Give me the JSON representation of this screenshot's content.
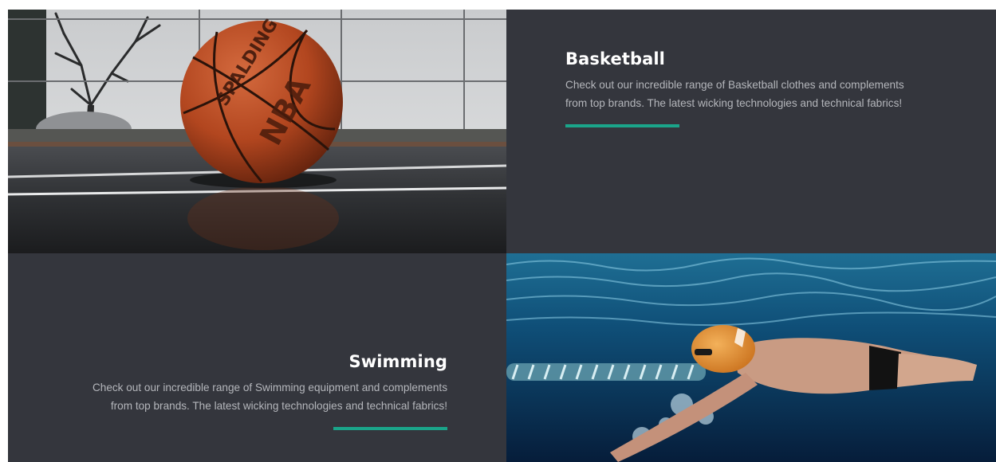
{
  "sections": [
    {
      "title": "Basketball",
      "description_line1": "Check out our incredible range of Basketball clothes and complements",
      "description_line2": "from top brands. The latest wicking technologies and technical fabrics!",
      "image": "basketball-photo",
      "ball_brand_text": "SPALDING",
      "ball_logo_text": "NBA"
    },
    {
      "title": "Swimming",
      "description_line1": "Check out our incredible range of Swimming equipment and complements",
      "description_line2": "from top brands. The latest wicking technologies and technical fabrics!",
      "image": "swimmer-photo"
    }
  ],
  "colors": {
    "panel_bg": "#34363d",
    "accent": "#1aa58a",
    "title": "#ffffff",
    "text": "#b4b6bb"
  }
}
